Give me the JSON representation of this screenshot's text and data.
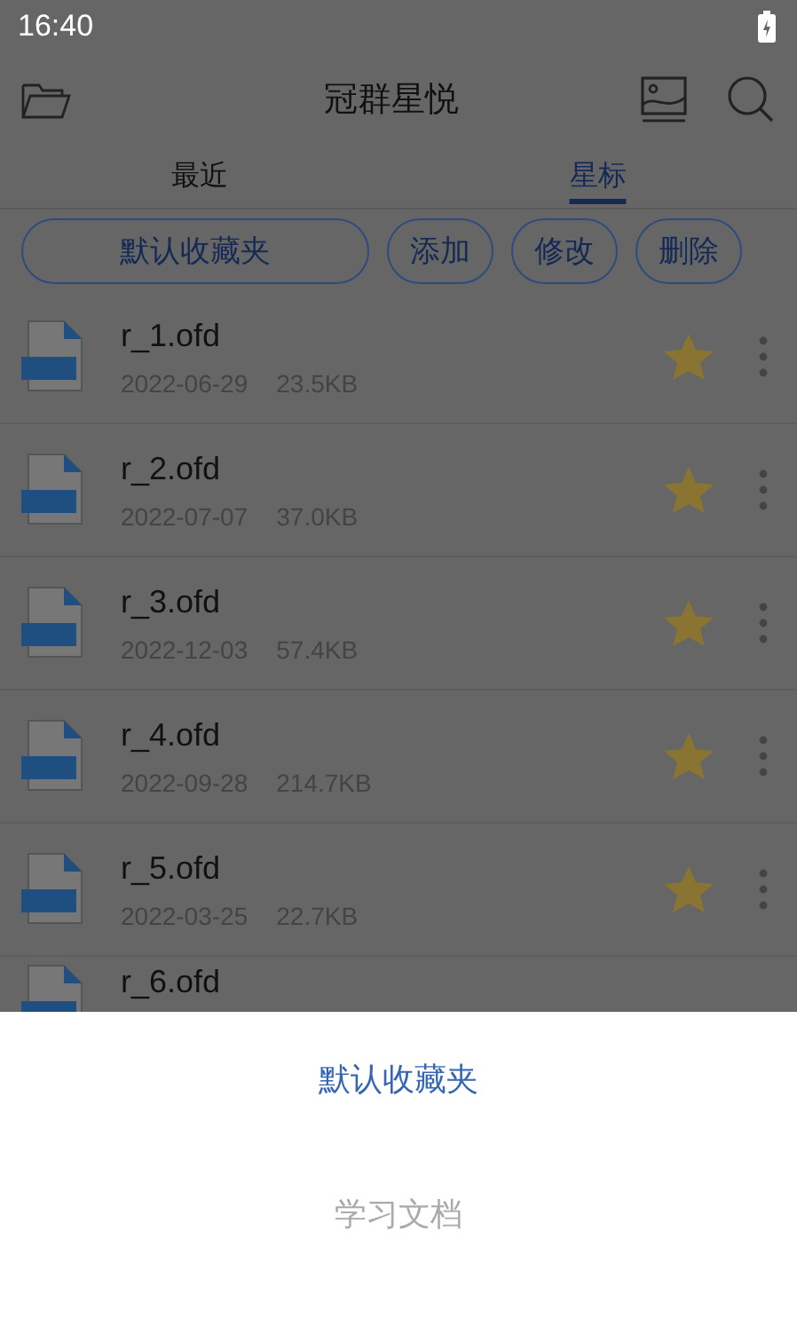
{
  "status_bar": {
    "time": "16:40"
  },
  "header": {
    "title": "冠群星悦"
  },
  "tabs": [
    {
      "label": "最近",
      "selected": false
    },
    {
      "label": "星标",
      "selected": true
    }
  ],
  "folder_buttons": [
    {
      "label": "默认收藏夹",
      "kind": "wide"
    },
    {
      "label": "添加",
      "kind": "small"
    },
    {
      "label": "修改",
      "kind": "small"
    },
    {
      "label": "删除",
      "kind": "small"
    }
  ],
  "files": [
    {
      "name": "r_1.ofd",
      "date": "2022-06-29",
      "size": "23.5KB",
      "starred": true
    },
    {
      "name": "r_2.ofd",
      "date": "2022-07-07",
      "size": "37.0KB",
      "starred": true
    },
    {
      "name": "r_3.ofd",
      "date": "2022-12-03",
      "size": "57.4KB",
      "starred": true
    },
    {
      "name": "r_4.ofd",
      "date": "2022-09-28",
      "size": "214.7KB",
      "starred": true
    },
    {
      "name": "r_5.ofd",
      "date": "2022-03-25",
      "size": "22.7KB",
      "starred": true
    },
    {
      "name": "r_6.ofd"
    }
  ],
  "sheet": {
    "items": [
      {
        "label": "默认收藏夹",
        "selected": true
      },
      {
        "label": "学习文档",
        "selected": false
      }
    ]
  }
}
